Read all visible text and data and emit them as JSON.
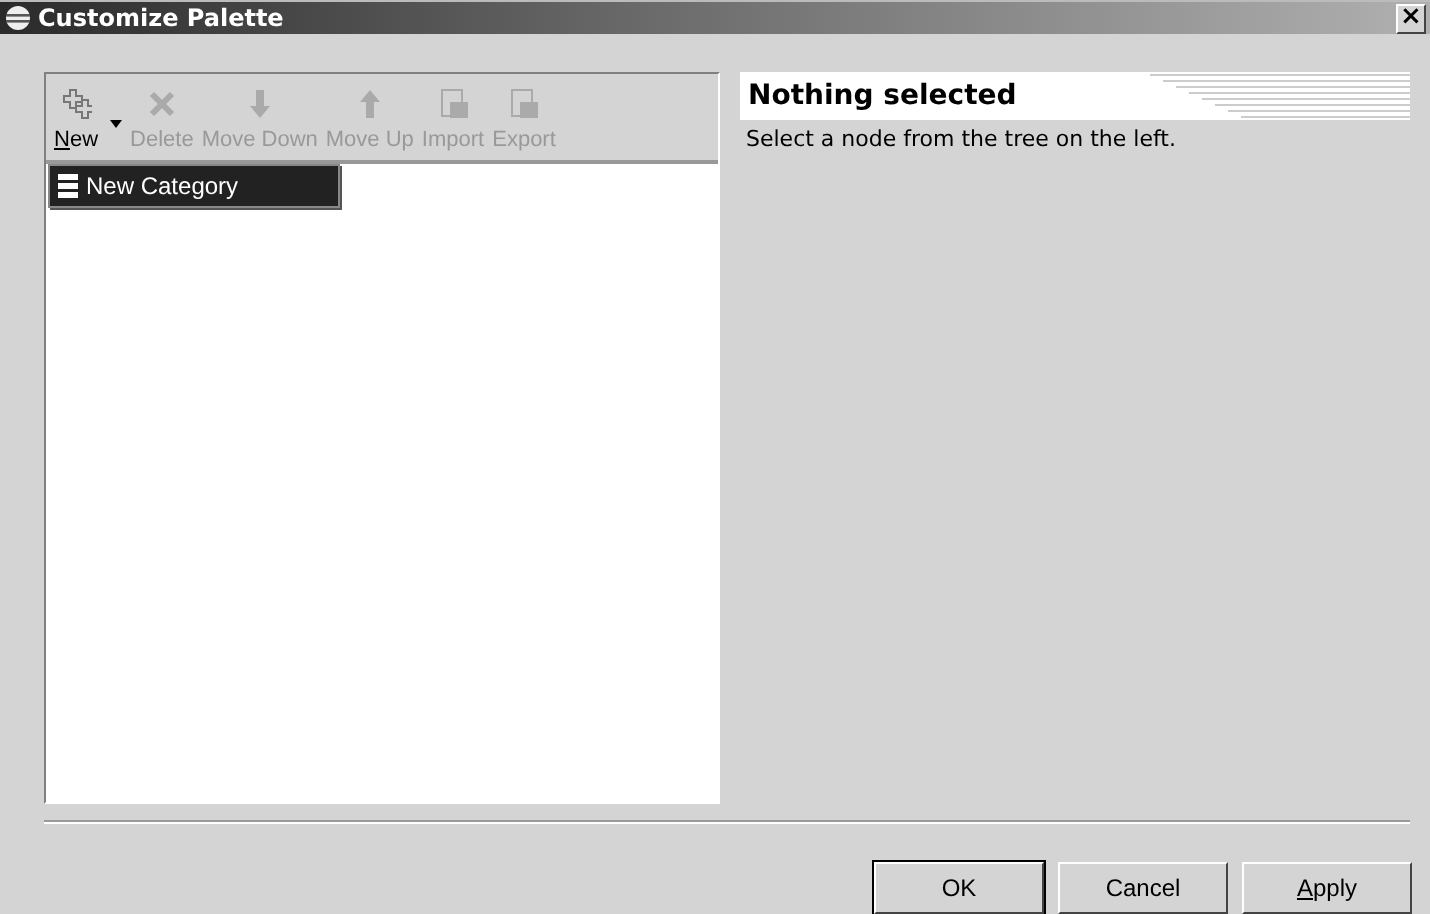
{
  "window": {
    "title": "Customize Palette",
    "close": "×"
  },
  "toolbar": [
    {
      "label": "New",
      "kind": "plus",
      "disabled": false,
      "underline_first": true,
      "dropdown": true
    },
    {
      "label": "Delete",
      "kind": "delete",
      "disabled": true,
      "underline_first": false,
      "dropdown": false
    },
    {
      "label": "Move Down",
      "kind": "down",
      "disabled": true,
      "underline_first": false,
      "dropdown": false
    },
    {
      "label": "Move Up",
      "kind": "up",
      "disabled": true,
      "underline_first": false,
      "dropdown": false
    },
    {
      "label": "Import",
      "kind": "file",
      "disabled": true,
      "underline_first": false,
      "dropdown": false
    },
    {
      "label": "Export",
      "kind": "file",
      "disabled": true,
      "underline_first": false,
      "dropdown": false
    }
  ],
  "menu": [
    {
      "label": "New Category",
      "selected": true
    }
  ],
  "details": {
    "title": "Nothing selected",
    "description": "Select a node from the tree on the left."
  },
  "buttons": [
    {
      "label": "OK",
      "underline_first": false,
      "default": true
    },
    {
      "label": "Cancel",
      "underline_first": false,
      "default": false
    },
    {
      "label": "Apply",
      "underline_first": true,
      "default": false
    }
  ]
}
